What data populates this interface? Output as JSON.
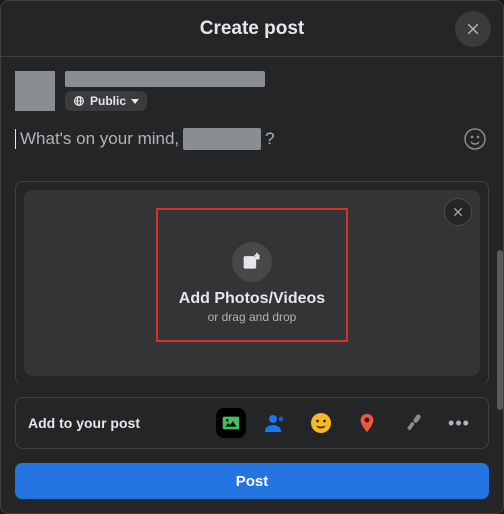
{
  "header": {
    "title": "Create post"
  },
  "audience": {
    "label": "Public"
  },
  "composer": {
    "placeholder_prefix": "What's on your mind, ",
    "placeholder_suffix": "?"
  },
  "dropzone": {
    "title": "Add Photos/Videos",
    "subtitle": "or drag and drop"
  },
  "addons": {
    "label": "Add to your post"
  },
  "actions": {
    "post_label": "Post"
  },
  "colors": {
    "accent": "#2374e1",
    "highlight": "#d93025",
    "photo_icon": "#45bd62",
    "tag_icon": "#1877f2",
    "feeling_icon": "#f7b928",
    "location_icon": "#f5533d",
    "mic_icon": "#8a8d91"
  }
}
